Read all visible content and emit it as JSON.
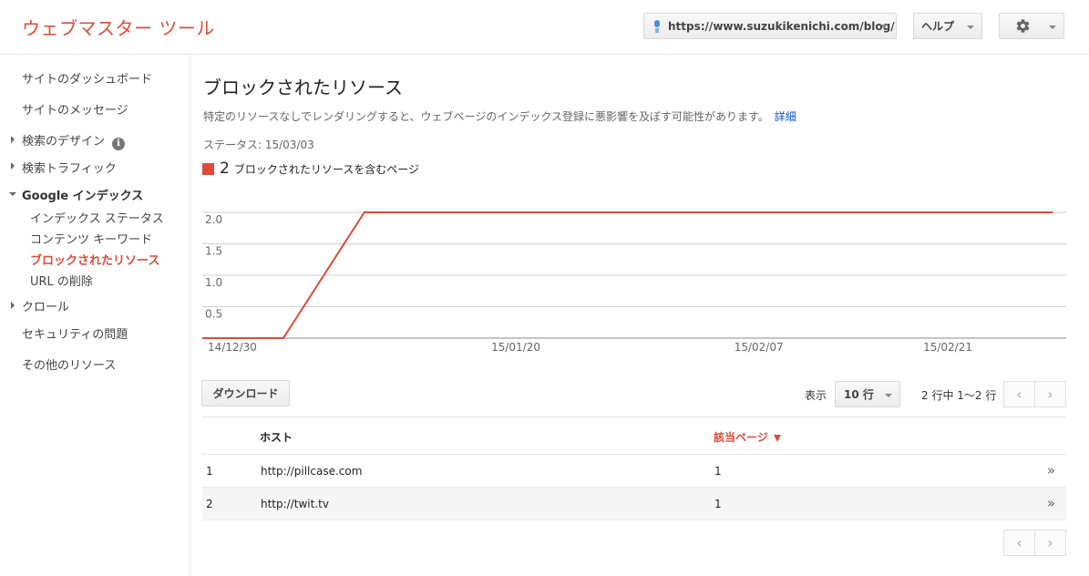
{
  "header": {
    "title": "ウェブマスター ツール",
    "site_url": "https://www.suzukikenichi.com/blog/",
    "help_label": "ヘルプ",
    "settings_icon": "gear-icon"
  },
  "sidebar": {
    "items": [
      {
        "label": "サイトのダッシュボード"
      },
      {
        "label": "サイトのメッセージ"
      },
      {
        "label": "検索のデザイン"
      },
      {
        "label": "検索トラフィック"
      },
      {
        "label": "Google インデックス"
      },
      {
        "label": "インデックス ステータス"
      },
      {
        "label": "コンテンツ キーワード"
      },
      {
        "label": "ブロックされたリソース"
      },
      {
        "label": "URL の削除"
      },
      {
        "label": "クロール"
      },
      {
        "label": "セキュリティの問題"
      },
      {
        "label": "その他のリソース"
      }
    ],
    "info_glyph": "i"
  },
  "main": {
    "title": "ブロックされたリソース",
    "description": "特定のリソースなしでレンダリングすると、ウェブページのインデックス登録に悪影響を及ぼす可能性があります。",
    "details_link": "詳細",
    "status": "ステータス: 15/03/03",
    "legend": {
      "count": "2",
      "label": "ブロックされたリソースを含むページ",
      "color": "#dd4b39"
    }
  },
  "chart_data": {
    "type": "line",
    "series": [
      {
        "name": "ブロックされたリソースを含むページ",
        "color": "#dd4b39",
        "points": [
          {
            "x": "2014-12-30",
            "y": 0
          },
          {
            "x": "2015-01-05",
            "y": 0
          },
          {
            "x": "2015-01-11",
            "y": 2
          },
          {
            "x": "2015-03-03",
            "y": 2
          }
        ]
      }
    ],
    "x_ticks": [
      "14/12/30",
      "15/01/20",
      "15/02/07",
      "15/02/21"
    ],
    "y_ticks": [
      "0.5",
      "1.0",
      "1.5",
      "2.0"
    ],
    "ylim": [
      0,
      2.0
    ],
    "xlim": [
      "2014-12-30",
      "2015-03-04"
    ],
    "grid": true
  },
  "controls": {
    "download_label": "ダウンロード",
    "rows_label": "表示",
    "rows_value": "10 行",
    "range_text": "2 行中 1〜2 行"
  },
  "table": {
    "headers": [
      "ホスト",
      "該当ページ"
    ],
    "rows": [
      {
        "index": "1",
        "host": "http://pillcase.com",
        "pages": "1"
      },
      {
        "index": "2",
        "host": "http://twit.tv",
        "pages": "1"
      }
    ]
  }
}
